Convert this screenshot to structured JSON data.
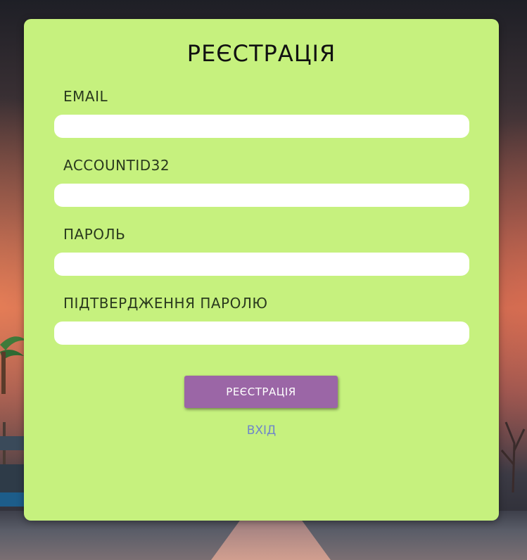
{
  "form": {
    "title": "РЕЄСТРАЦІЯ",
    "fields": [
      {
        "label": "EMAIL",
        "value": "",
        "placeholder": ""
      },
      {
        "label": "ACCOUNTID32",
        "value": "",
        "placeholder": ""
      },
      {
        "label": "ПАРОЛЬ",
        "value": "",
        "placeholder": ""
      },
      {
        "label": "ПІДТВЕРДЖЕННЯ ПАРОЛЮ",
        "value": "",
        "placeholder": ""
      }
    ],
    "submit_label": "РЕЄСТРАЦІЯ",
    "login_link_label": "ВХІД"
  },
  "colors": {
    "card_background": "#c6f17e",
    "button_background": "#9b66a6",
    "link": "#6f86c9"
  }
}
